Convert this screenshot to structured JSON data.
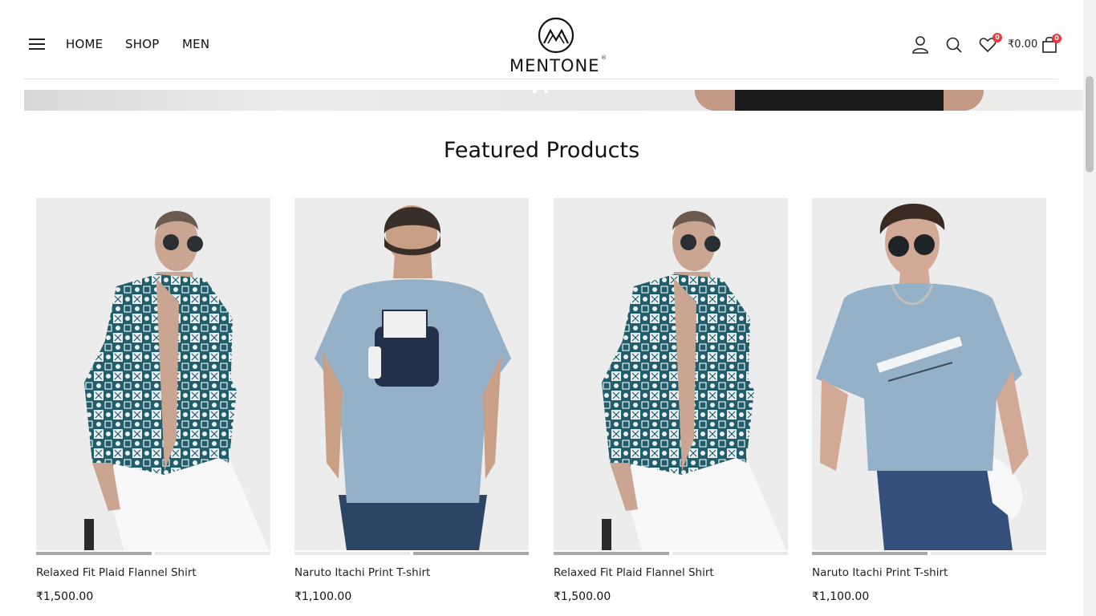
{
  "header": {
    "nav": [
      {
        "label": "HOME"
      },
      {
        "label": "SHOP"
      },
      {
        "label": "MEN"
      }
    ],
    "logo_text": "MENTONE",
    "logo_reg": "®",
    "wishlist_count": "0",
    "cart_count": "0",
    "cart_total": "₹0.00",
    "icons": [
      "menu-icon",
      "user-icon",
      "search-icon",
      "heart-icon",
      "bag-icon"
    ]
  },
  "section": {
    "title": "Featured Products"
  },
  "products": [
    {
      "name": "Relaxed Fit Plaid Flannel Shirt",
      "price": "₹1,500.00",
      "image_progress": 0.5,
      "active_image": 1
    },
    {
      "name": "Naruto Itachi Print T-shirt",
      "price": "₹1,100.00",
      "image_progress": 0.5,
      "active_image": 2
    },
    {
      "name": "Relaxed Fit Plaid Flannel Shirt",
      "price": "₹1,500.00",
      "image_progress": 0.5,
      "active_image": 1
    },
    {
      "name": "Naruto Itachi Print T-shirt",
      "price": "₹1,100.00",
      "image_progress": 0.5,
      "active_image": 1
    }
  ],
  "colors": {
    "accent": "#e5393d",
    "shirt_teal": "#1f5e6a",
    "tshirt_blue": "#94b1c8"
  }
}
